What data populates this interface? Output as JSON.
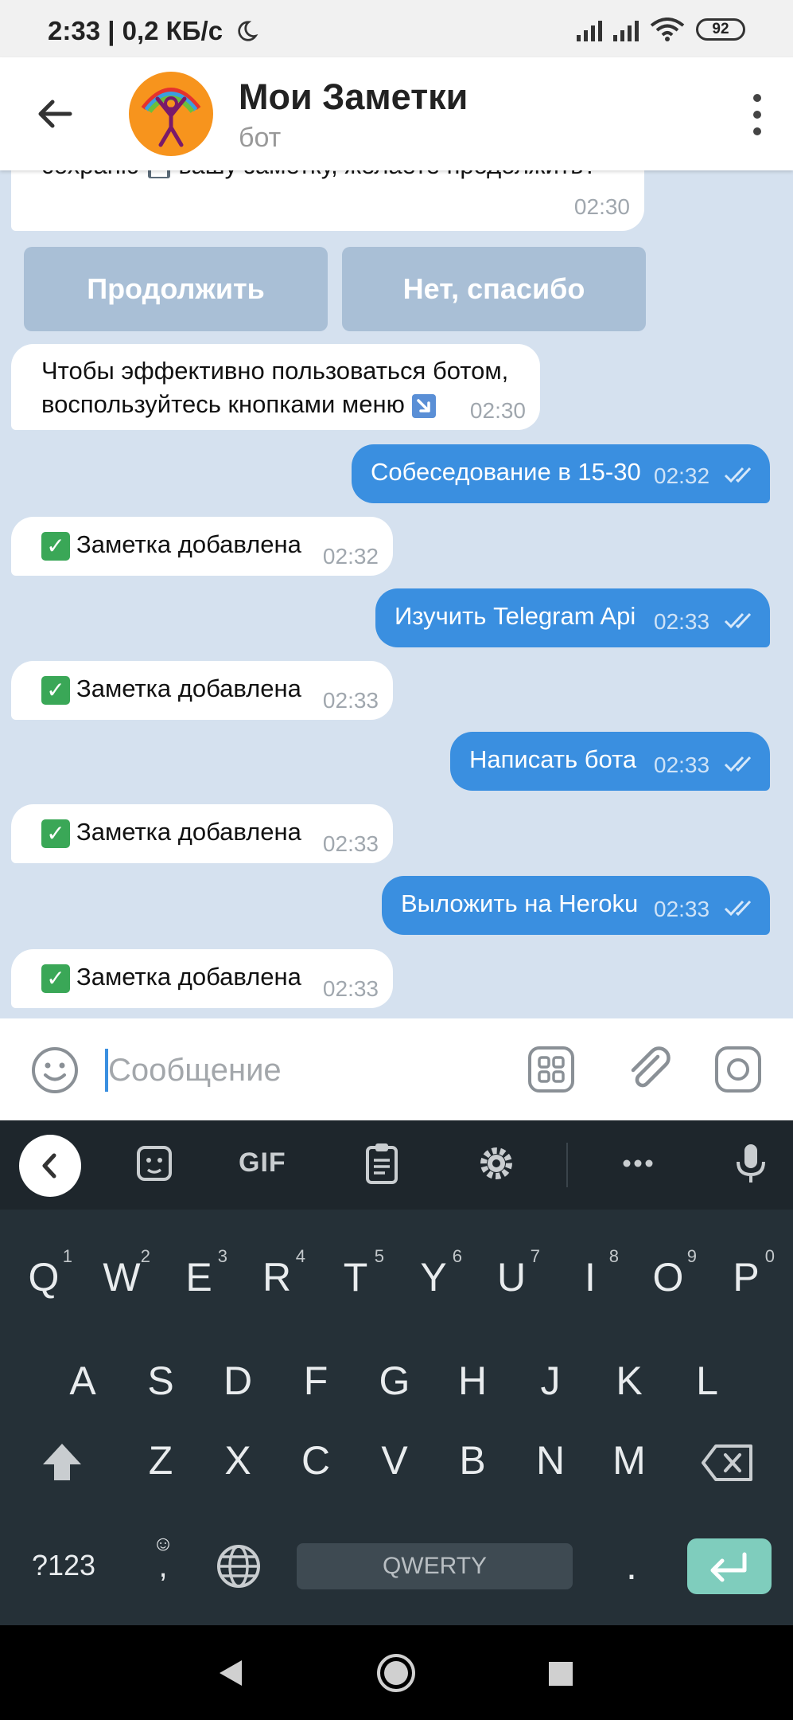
{
  "status_bar": {
    "time": "2:33 | 0,2 КБ/с",
    "battery": "92"
  },
  "header": {
    "title": "Мои Заметки",
    "subtitle": "бот"
  },
  "messages": [
    {
      "type": "in",
      "text": "сохраню  вашу заметку, желаете продолжить?",
      "time": "02:30"
    },
    {
      "type": "in",
      "text": "Чтобы эффективно пользоваться ботом,",
      "text2": "воспользуйтесь кнопками меню",
      "time": "02:30"
    },
    {
      "type": "out",
      "text": "Собеседование в 15-30",
      "time": "02:32"
    },
    {
      "type": "in",
      "text": "Заметка добавлена",
      "time": "02:32"
    },
    {
      "type": "out",
      "text": "Изучить Telegram Api",
      "time": "02:33"
    },
    {
      "type": "in",
      "text": "Заметка добавлена",
      "time": "02:33"
    },
    {
      "type": "out",
      "text": "Написать бота",
      "time": "02:33"
    },
    {
      "type": "in",
      "text": "Заметка добавлена",
      "time": "02:33"
    },
    {
      "type": "out",
      "text": "Выложить на Heroku",
      "time": "02:33"
    },
    {
      "type": "in",
      "text": "Заметка добавлена",
      "time": "02:33"
    }
  ],
  "inline_buttons": {
    "continue": "Продолжить",
    "no_thanks": "Нет, спасибо"
  },
  "input": {
    "placeholder": "Сообщение"
  },
  "keyboard": {
    "toolbar_gif": "GIF",
    "row1": [
      "Q",
      "W",
      "E",
      "R",
      "T",
      "Y",
      "U",
      "I",
      "O",
      "P"
    ],
    "row1_nums": [
      "1",
      "2",
      "3",
      "4",
      "5",
      "6",
      "7",
      "8",
      "9",
      "0"
    ],
    "row2": [
      "A",
      "S",
      "D",
      "F",
      "G",
      "H",
      "J",
      "K",
      "L"
    ],
    "row3": [
      "Z",
      "X",
      "C",
      "V",
      "B",
      "N",
      "M"
    ],
    "sym_key": "?123",
    "comma_key": ",",
    "period_key": ".",
    "space_label": "QWERTY"
  },
  "colors": {
    "chat_bg": "#d5e1ef",
    "out_bubble": "#3a8fe0",
    "in_bubble": "#ffffff",
    "inline_button": "#a9bfd6",
    "enter_key": "#7fcdbd"
  }
}
